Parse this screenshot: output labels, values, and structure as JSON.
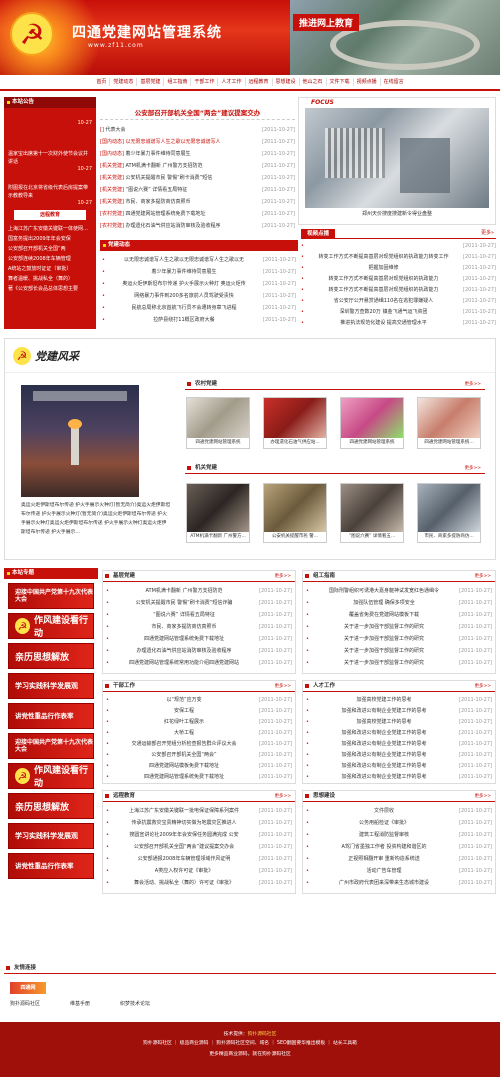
{
  "header": {
    "title": "四通党建网站管理系统",
    "url": "www.zf11.com",
    "slogan": "推进网上教育"
  },
  "nav": [
    "首页",
    "党建动态",
    "基层党建",
    "组工指南",
    "干部工作",
    "人才工作",
    "远程教育",
    "思想建设",
    "他山之石",
    "文件下载",
    "视频点播",
    "在线留言"
  ],
  "notice": {
    "title": "本站公告",
    "items": [
      {
        "text": "",
        "date": "10-27"
      },
      {
        "text": "温家宝出席第十一次财外使节会议并讲话",
        "date": "10-27"
      },
      {
        "text": "附图报在北京将省级代表后房提案带示教教导来",
        "date": "10-27"
      }
    ]
  },
  "remote": {
    "title": "远程教育",
    "items": [
      "上海江苏广东安徽关键联一体使网奥校支实堂盛神扣雷网",
      "国富务提出2009年年会安保",
      "公安部召开部机关全国“两",
      "公安部连续2008年车辆管理",
      "A统站之鼓放时证证（审批）",
      "舞者温暖、挑战私全（舞的）",
      "著《公安部长会品总体思想主要"
    ]
  },
  "headline": {
    "title": "公安部召开部机关全国“两会”建议提案交办",
    "items": [
      {
        "tag": "[]",
        "text": "代表大会",
        "date": "[2011-10-27]"
      },
      {
        "tag": "[国内动态]",
        "text": "以无限忠诚谱写人生之歌以无限忠诚谱写人",
        "date": "[2011-10-27]"
      },
      {
        "tag": "[国内动态]",
        "text": "着少年暴力事件维待同意展生",
        "date": "[2011-10-27]"
      },
      {
        "tag": "[机关党建]",
        "text": "ATM机满卡翻新 广州警方支招防范",
        "date": "[2011-10-27]"
      },
      {
        "tag": "[机关党建]",
        "text": "公安机关提醒市民 警惕“刷卡消费”短信",
        "date": "[2011-10-27]"
      },
      {
        "tag": "[机关党建]",
        "text": "“图说六赛” 详情看五局特征",
        "date": "[2011-10-27]"
      },
      {
        "tag": "[机关党建]",
        "text": "市民、商家多提防商仿真照币",
        "date": "[2011-10-27]"
      },
      {
        "tag": "[农村党建]",
        "text": "四通党建网站管理系统免费下载地址",
        "date": "[2011-10-27]"
      },
      {
        "tag": "[农村党建]",
        "text": "办理遗化石油气供应站消防审核及验收程序",
        "date": "[2011-10-27]"
      }
    ]
  },
  "focus": {
    "label": "FOCUS",
    "caption": "郑州天价搜度搜建新令得业盘整"
  },
  "party_news": {
    "title": "党建动态",
    "items": [
      {
        "text": "以无限忠诚谱写人生之歌以无限忠诚谱写人生之歌以无",
        "date": "[2011-10-27]"
      },
      {
        "text": "着少年暴力事件维待同意展生",
        "date": "[2011-10-27]"
      },
      {
        "text": "奥运火炬伊斯坦布尔传递 护火手展示火种灯 奥运火炬传",
        "date": "[2011-10-27]"
      },
      {
        "text": "网络暴力事件到200多名旅前人员驾驶受责快",
        "date": "[2011-10-27]"
      },
      {
        "text": "民航总局称北京首航飞行员不会遭转身章飞进程",
        "date": "[2011-10-27]"
      },
      {
        "text": "拉萨县绕打11概区政府大餐",
        "date": "[2011-10-27]"
      }
    ]
  },
  "video": {
    "title": "视频点播",
    "items": [
      {
        "text": "",
        "date": "[2011-10-27]"
      },
      {
        "text": "转变工作方式不断提高基层对现党组织的执政能力转变工作",
        "date": "[2011-10-27]"
      },
      {
        "text": "把握加固维修",
        "date": "[2011-10-27]"
      },
      {
        "text": "转变工作方式不断提高基层对现党组织的执政能力",
        "date": "[2011-10-27]"
      },
      {
        "text": "转变工作方式不断提高基层对现党组织的执政能力",
        "date": "[2011-10-27]"
      },
      {
        "text": "省公安厅公开悬赏通缉110名在逃犯罪嫌疑人",
        "date": "[2011-10-27]"
      },
      {
        "text": "深圳警方查数20万 镇金飞通气运飞资团",
        "date": "[2011-10-27]"
      },
      {
        "text": "推进执法规范化建设 提高交通管理水平",
        "date": "[2011-10-27]"
      }
    ]
  },
  "mien": {
    "title": "党建风采",
    "story": "奥运火炬伊斯坦布尔传递 护火手展示火种灯(暂无简介)奥运火炬伊斯坦布尔传递 护火手展示火种灯(暂无简介)奥运火炬伊斯坦布尔传递 护火手展示火种灯奥运火炬伊斯坦布尔传递 护火手展示火种灯奥运火炬伊斯坦布尔传递 护火手展示..."
  },
  "rural": {
    "title": "农村党建",
    "more": "更多>>",
    "items": [
      "四通党建网站管理系统",
      "办理遗化石油气供应站...",
      "四通党建网站管理系统",
      "四通党建网站管理系统..."
    ]
  },
  "organ": {
    "title": "机关党建",
    "more": "更多>>",
    "items": [
      "ATM机满卡翻新 广州警方...",
      "公安机关提醒市民 警...",
      "“图说六赛” 详情看五...",
      "市民、商家多提防商仿..."
    ]
  },
  "topics": {
    "title": "本站专题",
    "banners": [
      "迎接中国共产党第十九次代表大会",
      "作风建设看行动",
      "亲历思想解放",
      "学习实践科学发展观",
      "讲党性重品行作表率",
      "迎接中国共产党第十九次代表大会",
      "作风建设看行动",
      "亲历思想解放",
      "学习实践科学发展观",
      "讲党性重品行作表率"
    ]
  },
  "grassroots": {
    "title": "基层党建",
    "more": "更多>>",
    "items": [
      {
        "text": "ATM机满卡翻新 广州警方支招防范",
        "date": "[2011-10-27]"
      },
      {
        "text": "公安机关提醒市民 警惕“刷卡消费”短信诈骗",
        "date": "[2011-10-27]"
      },
      {
        "text": "“图说六赛” 详情看五局特征",
        "date": "[2011-10-27]"
      },
      {
        "text": "市民、商家多提防商仿真照币",
        "date": "[2011-10-27]"
      },
      {
        "text": "四通党建网站管理系统免费下载地址",
        "date": "[2011-10-27]"
      },
      {
        "text": "办理遗化石油气供应站消防审核及验收程序",
        "date": "[2011-10-27]"
      },
      {
        "text": "四通党建网站管理系统常用功能介绍四通党建网站",
        "date": "[2011-10-27]"
      }
    ]
  },
  "guide": {
    "title": "组工指南",
    "more": "更多>>",
    "items": [
      {
        "text": "国际刑警组织可诱港大嘉身躯神试发宽红色通缉令",
        "date": "[2011-10-27]"
      },
      {
        "text": "加强队伍管理 确保多项安全",
        "date": "[2011-10-27]"
      },
      {
        "text": "覆盖省免费在党建网站模板下载",
        "date": "[2011-10-27]"
      },
      {
        "text": "关于进一步加强干部监督工作的研究",
        "date": "[2011-10-27]"
      },
      {
        "text": "关于进一步加强干部监督工作的研究",
        "date": "[2011-10-27]"
      },
      {
        "text": "关于进一步加强干部监督工作的研究",
        "date": "[2011-10-27]"
      },
      {
        "text": "关于进一步加强干部监督工作的研究",
        "date": "[2011-10-27]"
      }
    ]
  },
  "cadre": {
    "title": "干部工作",
    "more": "更多>>",
    "items": [
      {
        "text": "以“规范”应万变",
        "date": "[2011-10-27]"
      },
      {
        "text": "安保工程",
        "date": "[2011-10-27]"
      },
      {
        "text": "红花绿叶工程展示",
        "date": "[2011-10-27]"
      },
      {
        "text": "大桥工程",
        "date": "[2011-10-27]"
      },
      {
        "text": "交通运输部召开党组分析检查报告群众评议大会",
        "date": "[2011-10-27]"
      },
      {
        "text": "公安部召开部机关全国“两会”",
        "date": "[2011-10-27]"
      },
      {
        "text": "四通党建网站模板免费下载地址",
        "date": "[2011-10-27]"
      },
      {
        "text": "四通党建网站管理系统免费下载地址",
        "date": "[2011-10-27]"
      }
    ]
  },
  "talent": {
    "title": "人才工作",
    "more": "更多>>",
    "items": [
      {
        "text": "加强高校党建工作的思考",
        "date": "[2011-10-27]"
      },
      {
        "text": "加强和改进公有制企业党建工作的思考",
        "date": "[2011-10-27]"
      },
      {
        "text": "加强高校党建工作的思考",
        "date": "[2011-10-27]"
      },
      {
        "text": "加强和改进公有制企业党建工作的思考",
        "date": "[2011-10-27]"
      },
      {
        "text": "加强和改进公有制企业党建工作的思考",
        "date": "[2011-10-27]"
      },
      {
        "text": "加强和改进公有制企业党建工作的思考",
        "date": "[2011-10-27]"
      },
      {
        "text": "加强和改进公有制企业党建工作的思考",
        "date": "[2011-10-27]"
      },
      {
        "text": "加强和改进公有制企业党建工作的思考",
        "date": "[2011-10-27]"
      }
    ]
  },
  "distance": {
    "title": "远程教育",
    "more": "更多>>",
    "items": [
      {
        "text": "上海江苏广东安徽关键联一批电保证保障系列案件",
        "date": "[2011-10-27]"
      },
      {
        "text": "传承抗震救灾宝贵精神切实做为地震灾区推进人",
        "date": "[2011-10-27]"
      },
      {
        "text": "搜圆宣讲论社2009年年会安保任务圆满完成 公安",
        "date": "[2011-10-27]"
      },
      {
        "text": "公安部召开部机关全国“两会”建议提案交办会",
        "date": "[2011-10-27]"
      },
      {
        "text": "公安部通报2008年车辆管理领域作风证明",
        "date": "[2011-10-27]"
      },
      {
        "text": "A类应入权许可证《审批》",
        "date": "[2011-10-27]"
      },
      {
        "text": "舞会活动、挑战私全（舞的）许可证《审批》",
        "date": "[2011-10-27]"
      }
    ]
  },
  "thought": {
    "title": "思想建设",
    "more": "更多>>",
    "items": [
      {
        "text": "文件层收",
        "date": "[2011-10-27]"
      },
      {
        "text": "公务用船检证《审批》",
        "date": "[2011-10-27]"
      },
      {
        "text": "建筑工程消防监督审核",
        "date": "[2011-10-27]"
      },
      {
        "text": "A驾门省墨独工作者 投资构建和谐区的",
        "date": "[2011-10-27]"
      },
      {
        "text": "正视照相翻开审 重新构造系统送",
        "date": "[2011-10-27]"
      },
      {
        "text": "活动广告车管理",
        "date": "[2011-10-27]"
      },
      {
        "text": "广州市政府代表团来深带来生态城市建设",
        "date": "[2011-10-27]"
      }
    ]
  },
  "links": {
    "title": "友情连接",
    "logo_text": "四通网",
    "items": [
      "狗扑源码社区",
      "维基手册",
      "织梦技术论坛"
    ]
  },
  "footer": {
    "line1": "技术提供：",
    "line1b": "狗扑源码社区",
    "line2": "狗扑源码社区 ｜ 极品商业源码 ｜ 狗扑源码社区空间、域名 ｜ SEO翻国要华推出模板 ｜ 站长工具箱",
    "line3": "更多精品商业源码，就在狗扑源码社区"
  }
}
